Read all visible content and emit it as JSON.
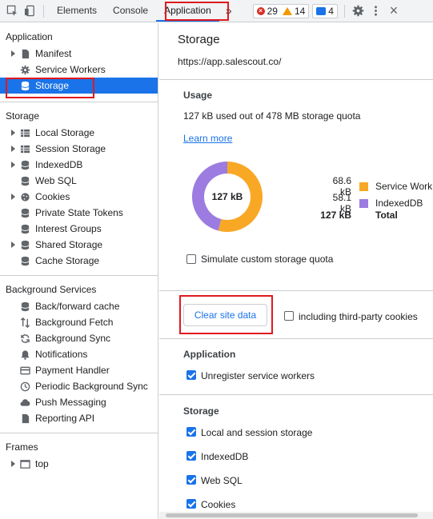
{
  "toolbar": {
    "tabs": [
      {
        "label": "Elements"
      },
      {
        "label": "Console"
      },
      {
        "label": "Application"
      }
    ],
    "more": "»",
    "errors": "29",
    "warnings": "14",
    "messages": "4",
    "close": "×"
  },
  "sidebar": {
    "application_title": "Application",
    "application_items": [
      {
        "label": "Manifest",
        "icon": "file-icon"
      },
      {
        "label": "Service Workers",
        "icon": "gear-icon"
      },
      {
        "label": "Storage",
        "icon": "database-icon"
      }
    ],
    "storage_title": "Storage",
    "storage_items": [
      {
        "label": "Local Storage",
        "icon": "grid-icon"
      },
      {
        "label": "Session Storage",
        "icon": "grid-icon"
      },
      {
        "label": "IndexedDB",
        "icon": "database-icon"
      },
      {
        "label": "Web SQL",
        "icon": "database-icon"
      },
      {
        "label": "Cookies",
        "icon": "cookie-icon"
      },
      {
        "label": "Private State Tokens",
        "icon": "database-icon"
      },
      {
        "label": "Interest Groups",
        "icon": "database-icon"
      },
      {
        "label": "Shared Storage",
        "icon": "database-icon"
      },
      {
        "label": "Cache Storage",
        "icon": "database-icon"
      }
    ],
    "background_title": "Background Services",
    "background_items": [
      {
        "label": "Back/forward cache",
        "icon": "database-icon"
      },
      {
        "label": "Background Fetch",
        "icon": "updown-arrows-icon"
      },
      {
        "label": "Background Sync",
        "icon": "sync-icon"
      },
      {
        "label": "Notifications",
        "icon": "bell-icon"
      },
      {
        "label": "Payment Handler",
        "icon": "card-icon"
      },
      {
        "label": "Periodic Background Sync",
        "icon": "clock-icon"
      },
      {
        "label": "Push Messaging",
        "icon": "cloud-icon"
      },
      {
        "label": "Reporting API",
        "icon": "file-icon"
      }
    ],
    "frames_title": "Frames",
    "frames_items": [
      {
        "label": "top",
        "icon": "frame-icon"
      }
    ]
  },
  "main": {
    "title": "Storage",
    "origin": "https://app.salescout.co/",
    "usage_heading": "Usage",
    "usage_text": "127 kB used out of 478 MB storage quota",
    "learn_more": "Learn more",
    "donut_center": "127 kB",
    "legend": [
      {
        "value": "68.6 kB",
        "label": "Service Work",
        "color": "#f9a825"
      },
      {
        "value": "58.1 kB",
        "label": "IndexedDB",
        "color": "#9c7ce0"
      }
    ],
    "total_value": "127 kB",
    "total_label": "Total",
    "simulate_label": "Simulate custom storage quota",
    "clear_button": "Clear site data",
    "third_party_label": "including third-party cookies",
    "app_heading": "Application",
    "unregister_label": "Unregister service workers",
    "storage_heading": "Storage",
    "storage_checks": [
      {
        "label": "Local and session storage"
      },
      {
        "label": "IndexedDB"
      },
      {
        "label": "Web SQL"
      },
      {
        "label": "Cookies"
      }
    ]
  }
}
